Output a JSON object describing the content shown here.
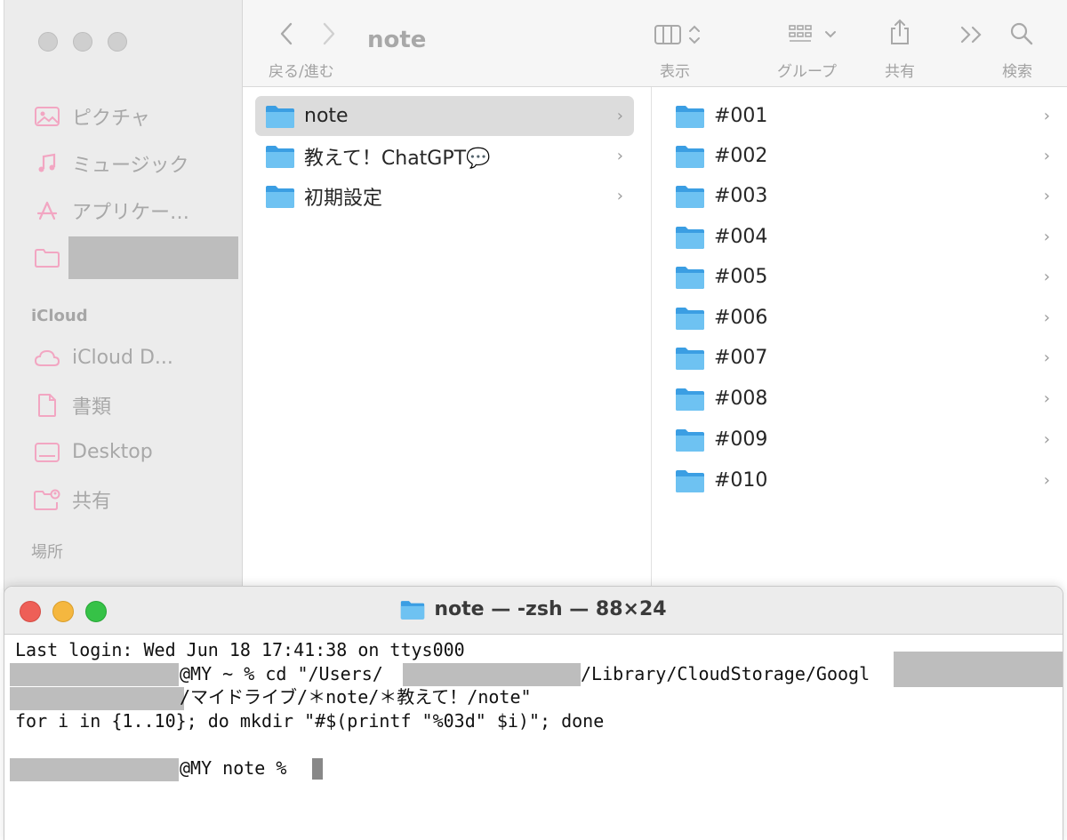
{
  "finder": {
    "sidebar": {
      "items": [
        {
          "label": "ピクチャ",
          "icon": "photo-icon"
        },
        {
          "label": "ミュージック",
          "icon": "music-icon"
        },
        {
          "label": "アプリケー…",
          "icon": "apps-icon"
        },
        {
          "label": "",
          "icon": "folder-outline-icon"
        }
      ],
      "sections": [
        {
          "title": "iCloud",
          "items": [
            {
              "label": "iCloud D...",
              "icon": "cloud-icon"
            },
            {
              "label": "書類",
              "icon": "document-icon"
            },
            {
              "label": "Desktop",
              "icon": "desktop-icon"
            },
            {
              "label": "共有",
              "icon": "shared-folder-icon"
            }
          ]
        },
        {
          "title": "場所",
          "items": []
        }
      ]
    },
    "toolbar": {
      "title": "note",
      "nav_label": "戻る/進む",
      "view_label": "表示",
      "group_label": "グループ",
      "share_label": "共有",
      "search_label": "検索"
    },
    "column1": [
      {
        "name": "note",
        "selected": true
      },
      {
        "name": "教えて！ChatGPT💬",
        "selected": false
      },
      {
        "name": "初期設定",
        "selected": false
      }
    ],
    "column2": [
      "#001",
      "#002",
      "#003",
      "#004",
      "#005",
      "#006",
      "#007",
      "#008",
      "#009",
      "#010"
    ]
  },
  "terminal": {
    "title": "note — -zsh — 88×24",
    "lines": [
      "Last login: Wed Jun 18 17:41:38 on ttys000",
      "@MY ~ % cd \"/Users/",
      "/Library/CloudStorage/Googl",
      "/マイドライブ/＊note/＊教えて！/note\"",
      "for i in {1..10}; do mkdir \"#$(printf \"%03d\" $i)\"; done",
      "",
      "@MY note % "
    ]
  },
  "colors": {
    "accent_folder": "#5ab4ee",
    "close": "#ee5f57",
    "minimize": "#f5b73f",
    "maximize": "#36c247"
  }
}
